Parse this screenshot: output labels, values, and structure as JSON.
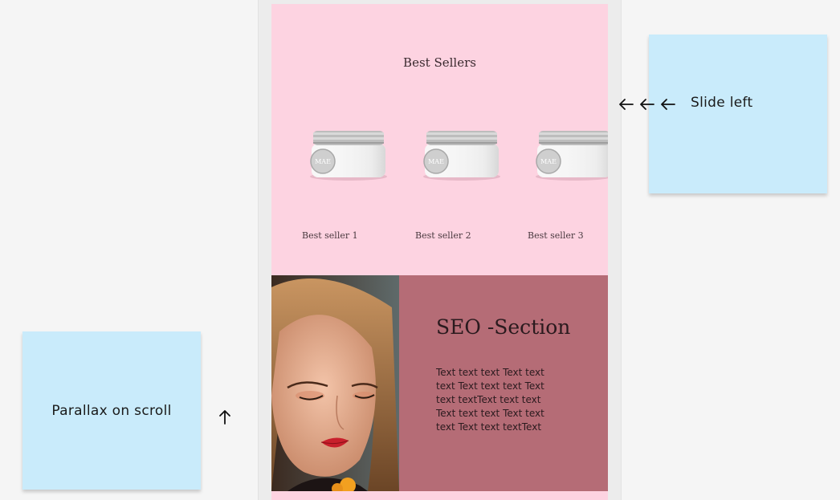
{
  "best_sellers": {
    "title": "Best Sellers",
    "products": [
      {
        "label": "Best seller 1",
        "jar_text": "MAE"
      },
      {
        "label": "Best seller 2",
        "jar_text": "MAE"
      },
      {
        "label": "Best seller 3",
        "jar_text": "MAE"
      }
    ]
  },
  "seo": {
    "title": "SEO -Section",
    "body": "Text text text Text text text Text text text Text text textText text text Text text text Text text text Text text textText"
  },
  "annotations": {
    "slide_note": "Slide left",
    "parallax_note": "Parallax on scroll"
  },
  "colors": {
    "best_sellers_bg": "#fdd3e1",
    "seo_bg": "#b56c76",
    "sticky_note": "#c9ebfb",
    "canvas_bg": "#f5f5f5"
  },
  "icons": [
    "arrow-left-icon",
    "arrow-up-icon"
  ]
}
